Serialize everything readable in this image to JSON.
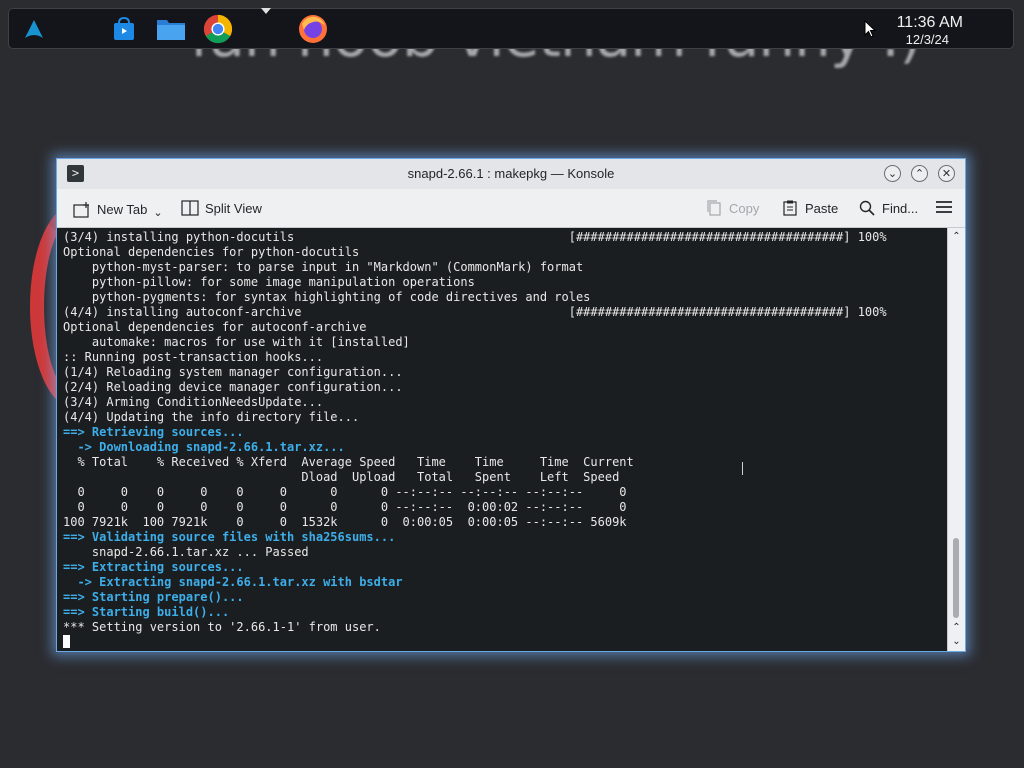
{
  "wallpaper": {
    "text": "fan noob vietnam funny :)"
  },
  "taskbar": {
    "items": [
      {
        "name": "app-launcher-icon",
        "color": "#1793d1"
      },
      {
        "name": "discover-store-icon",
        "color": "#1e88e5"
      },
      {
        "name": "file-manager-icon",
        "color": "#2b7cd3"
      },
      {
        "name": "chrome-icon",
        "color": "#4285f4"
      },
      {
        "name": "firefox-icon",
        "color": "#ff7139"
      }
    ],
    "clock": {
      "time": "11:36 AM",
      "date": "12/3/24"
    }
  },
  "window": {
    "title": "snapd-2.66.1 : makepkg — Konsole",
    "toolbar": {
      "new_tab": "New Tab",
      "split_view": "Split View",
      "copy": "Copy",
      "paste": "Paste",
      "find": "Find..."
    },
    "terminal": {
      "lines": [
        {
          "text": "(3/4) installing python-docutils                                      [#####################################] 100%",
          "style": ""
        },
        {
          "text": "Optional dependencies for python-docutils",
          "style": ""
        },
        {
          "text": "    python-myst-parser: to parse input in \"Markdown\" (CommonMark) format",
          "style": ""
        },
        {
          "text": "    python-pillow: for some image manipulation operations",
          "style": ""
        },
        {
          "text": "    python-pygments: for syntax highlighting of code directives and roles",
          "style": ""
        },
        {
          "text": "(4/4) installing autoconf-archive                                     [#####################################] 100%",
          "style": ""
        },
        {
          "text": "Optional dependencies for autoconf-archive",
          "style": ""
        },
        {
          "text": "    automake: macros for use with it [installed]",
          "style": ""
        },
        {
          "text": ":: Running post-transaction hooks...",
          "style": ""
        },
        {
          "text": "(1/4) Reloading system manager configuration...",
          "style": ""
        },
        {
          "text": "(2/4) Reloading device manager configuration...",
          "style": ""
        },
        {
          "text": "(3/4) Arming ConditionNeedsUpdate...",
          "style": ""
        },
        {
          "text": "(4/4) Updating the info directory file...",
          "style": ""
        },
        {
          "text": "==> Retrieving sources...",
          "style": "hl"
        },
        {
          "text": "  -> Downloading snapd-2.66.1.tar.xz...",
          "style": "hl"
        },
        {
          "text": "  % Total    % Received % Xferd  Average Speed   Time    Time     Time  Current",
          "style": ""
        },
        {
          "text": "                                 Dload  Upload   Total   Spent    Left  Speed",
          "style": ""
        },
        {
          "text": "  0     0    0     0    0     0      0      0 --:--:-- --:--:-- --:--:--     0",
          "style": ""
        },
        {
          "text": "  0     0    0     0    0     0      0      0 --:--:--  0:00:02 --:--:--     0",
          "style": ""
        },
        {
          "text": "100 7921k  100 7921k    0     0  1532k      0  0:00:05  0:00:05 --:--:-- 5609k",
          "style": ""
        },
        {
          "text": "==> Validating source files with sha256sums...",
          "style": "hl"
        },
        {
          "text": "    snapd-2.66.1.tar.xz ... Passed",
          "style": ""
        },
        {
          "text": "==> Extracting sources...",
          "style": "hl"
        },
        {
          "text": "  -> Extracting snapd-2.66.1.tar.xz with bsdtar",
          "style": "hl"
        },
        {
          "text": "==> Starting prepare()...",
          "style": "hl"
        },
        {
          "text": "==> Starting build()...",
          "style": "hl"
        },
        {
          "text": "*** Setting version to '2.66.1-1' from user.",
          "style": ""
        }
      ]
    }
  }
}
